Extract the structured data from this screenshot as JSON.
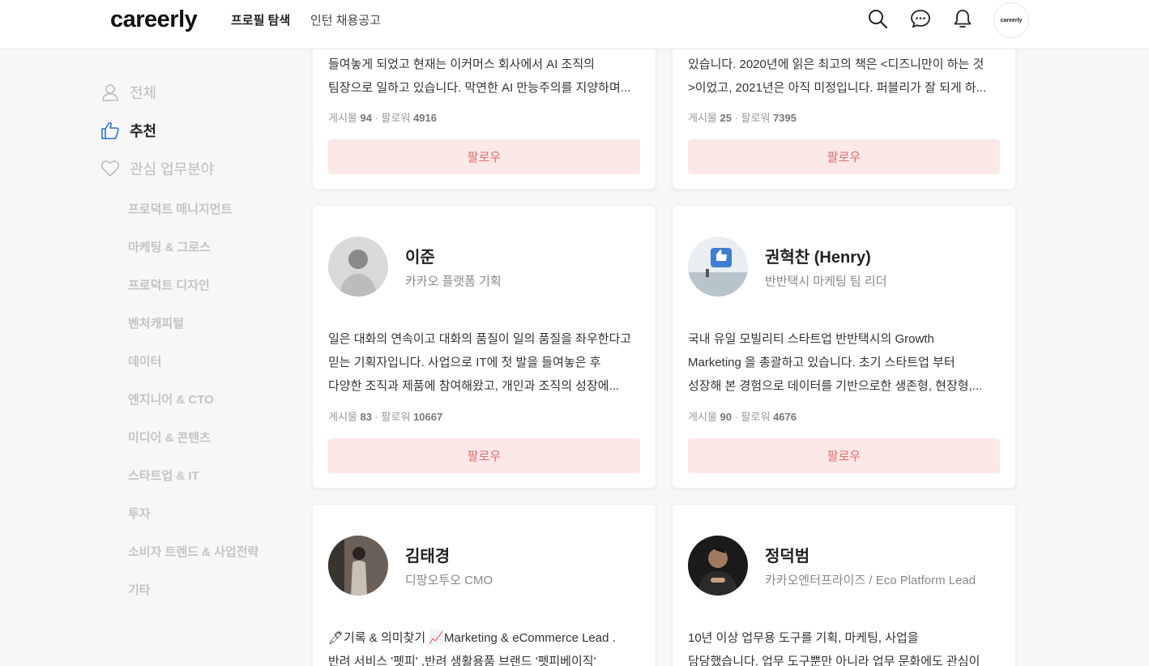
{
  "header": {
    "logo": "careerly",
    "nav": [
      "프로필 탐색",
      "인턴 채용공고"
    ],
    "avatar_text": "careerly"
  },
  "sidebar": {
    "items": [
      {
        "label": "전체",
        "icon": "person-icon"
      },
      {
        "label": "추천",
        "icon": "thumbs-up-icon"
      },
      {
        "label": "관심 업무분야",
        "icon": "heart-icon"
      }
    ],
    "categories": [
      "프로덕트 매니지먼트",
      "마케팅 & 그로스",
      "프로덕트 디자인",
      "벤처캐피털",
      "데이터",
      "엔지니어 & CTO",
      "미디어 & 콘텐츠",
      "스타트업 & IT",
      "투자",
      "소비자 트렌드 & 사업전략",
      "기타"
    ]
  },
  "cards": [
    {
      "bio": [
        "들여놓게 되었고 현재는 이커머스 회사에서 AI 조직의",
        "팀장으로 일하고 있습니다. 막연한 AI 만능주의를 지양하며..."
      ],
      "posts_label": "게시물",
      "posts": "94",
      "followers_label": "팔로워",
      "followers": "4916",
      "follow": "팔로우"
    },
    {
      "bio": [
        "있습니다. 2020년에 읽은 최고의 책은 <디즈니만이 하는 것",
        ">이었고, 2021년은 아직 미정입니다. 퍼블리가 잘 되게 하..."
      ],
      "posts_label": "게시물",
      "posts": "25",
      "followers_label": "팔로워",
      "followers": "7395",
      "follow": "팔로우"
    },
    {
      "name": "이준",
      "role": "카카오 플랫폼 기획",
      "bio": [
        "일은 대화의 연속이고 대화의 품질이 일의 품질을 좌우한다고",
        "믿는 기획자입니다. 사업으로 IT에 첫 발을 들여놓은 후",
        "다양한 조직과 제품에 참여해왔고, 개인과 조직의 성장에..."
      ],
      "posts_label": "게시물",
      "posts": "83",
      "followers_label": "팔로워",
      "followers": "10667",
      "follow": "팔로우"
    },
    {
      "name": "권혁찬 (Henry)",
      "role": "반반택시 마케팅 팀 리더",
      "bio": [
        "국내 유일 모빌리티 스타트업 반반택시의 Growth",
        "Marketing 을 총괄하고 있습니다. 초기 스타트업 부터",
        "성장해 본 경험으로 데이터를 기반으로한 생존형, 현장형,..."
      ],
      "posts_label": "게시물",
      "posts": "90",
      "followers_label": "팔로워",
      "followers": "4676",
      "follow": "팔로우"
    },
    {
      "name": "김태경",
      "role": "디팡오투오 CMO",
      "bio": [
        "🖊기록 & 의미찾기 📈Marketing & eCommerce Lead .",
        "반려 서비스 '펫피' ,반려 생활용품 브랜드 '펫피베이직'"
      ]
    },
    {
      "name": "정덕범",
      "role": "카카오엔터프라이즈 / Eco Platform Lead",
      "bio": [
        "10년 이상 업무용 도구를 기획, 마케팅, 사업을",
        "담당했습니다. 업무 도구뿐만 아니라 업무 문화에도 관심이"
      ]
    }
  ]
}
